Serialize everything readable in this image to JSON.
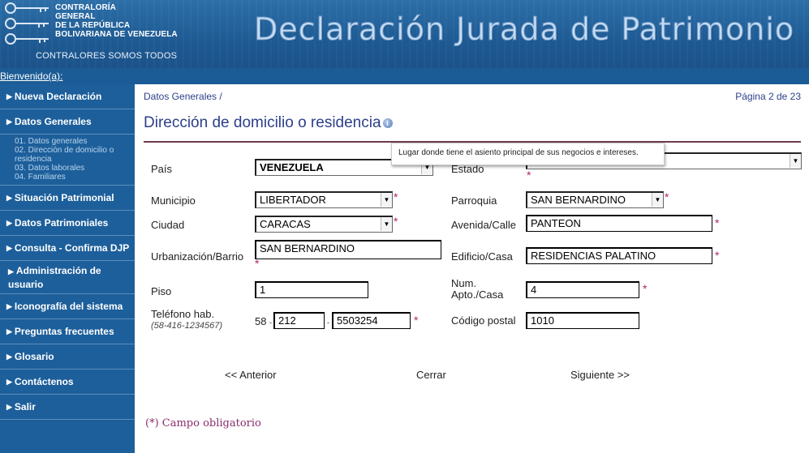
{
  "header": {
    "org_lines": [
      "CONTRALORÍA",
      "GENERAL",
      "DE LA REPÚBLICA",
      "BOLIVARIANA DE VENEZUELA"
    ],
    "motto": "CONTRALORES SOMOS TODOS",
    "title": "Declaración Jurada de Patrimonio",
    "welcome": "Bienvenido(a):"
  },
  "sidebar": {
    "items": [
      {
        "label": "Nueva Declaración"
      },
      {
        "label": "Datos Generales"
      },
      {
        "label": "Situación Patrimonial"
      },
      {
        "label": "Datos Patrimoniales"
      },
      {
        "label": "Consulta - Confirma DJP"
      },
      {
        "label": "Administración de usuario"
      },
      {
        "label": "Iconografía del sistema"
      },
      {
        "label": "Preguntas frecuentes"
      },
      {
        "label": "Glosario"
      },
      {
        "label": "Contáctenos"
      },
      {
        "label": "Salir"
      }
    ],
    "subitems": [
      "01. Datos generales",
      "02. Dirección de domicilio o residencia",
      "03. Datos laborales",
      "04. Familiares"
    ]
  },
  "main": {
    "breadcrumb": "Datos Generales /",
    "page": "Página 2 de 23",
    "section_title": "Dirección de domicilio o residencia",
    "tooltip": "Lugar donde tiene el asiento principal de sus negocios e intereses.",
    "required_mark": "*",
    "footnote": "(*) Campo obligatorio"
  },
  "form": {
    "pais": {
      "label": "País",
      "value": "VENEZUELA"
    },
    "estado": {
      "label": "Estado",
      "value": ""
    },
    "municipio": {
      "label": "Municipio",
      "value": "LIBERTADOR"
    },
    "parroquia": {
      "label": "Parroquia",
      "value": "SAN BERNARDINO"
    },
    "ciudad": {
      "label": "Ciudad",
      "value": "CARACAS"
    },
    "avenida": {
      "label": "Avenida/Calle",
      "value": "PANTEON"
    },
    "urbanizacion": {
      "label": "Urbanización/Barrio",
      "value": "SAN BERNARDINO"
    },
    "edificio": {
      "label": "Edificio/Casa",
      "value": "RESIDENCIAS PALATINO"
    },
    "piso": {
      "label": "Piso",
      "value": "1"
    },
    "apto": {
      "label_line1": "Num.",
      "label_line2": "Apto./Casa",
      "value": "4"
    },
    "telefono": {
      "label": "Teléfono hab.",
      "hint": "(58-416-1234567)",
      "country": "58",
      "sep": "-",
      "area": "212",
      "number": "5503254"
    },
    "postal": {
      "label": "Código postal",
      "value": "1010"
    }
  },
  "nav": {
    "prev": "<< Anterior",
    "close": "Cerrar",
    "next": "Siguiente >>"
  }
}
